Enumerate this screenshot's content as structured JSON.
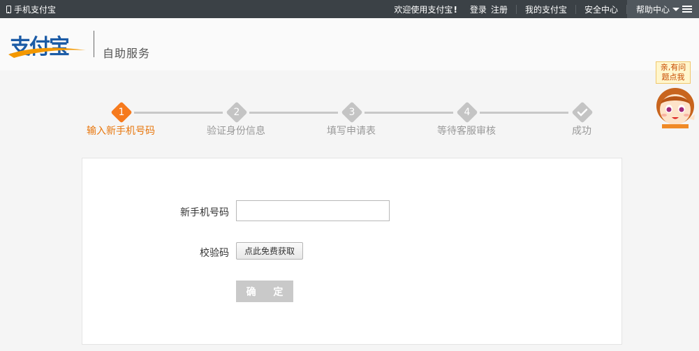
{
  "topbar": {
    "mobile_label": "手机支付宝",
    "welcome": "欢迎使用支付宝",
    "welcome_mark": "!",
    "login": "登录",
    "register": "注册",
    "my_alipay": "我的支付宝",
    "security_center": "安全中心",
    "help_center": "帮助中心"
  },
  "header": {
    "logo_text": "支付宝",
    "service_title": "自助服务"
  },
  "steps": [
    {
      "num": "1",
      "label": "输入新手机号码",
      "state": "active"
    },
    {
      "num": "2",
      "label": "验证身份信息",
      "state": "pending"
    },
    {
      "num": "3",
      "label": "填写申请表",
      "state": "pending"
    },
    {
      "num": "4",
      "label": "等待客服审核",
      "state": "pending"
    },
    {
      "num": "",
      "label": "成功",
      "state": "pending"
    }
  ],
  "mascot": {
    "bubble_line1": "亲,有问",
    "bubble_line2": "题点我"
  },
  "form": {
    "phone_label": "新手机号码",
    "phone_value": "",
    "code_label": "校验码",
    "code_button": "点此免费获取",
    "confirm_button": "确 定"
  },
  "colors": {
    "active_step": "#f67a1d",
    "pending_step": "#c4c4c4",
    "topbar_bg": "#3b4146"
  }
}
